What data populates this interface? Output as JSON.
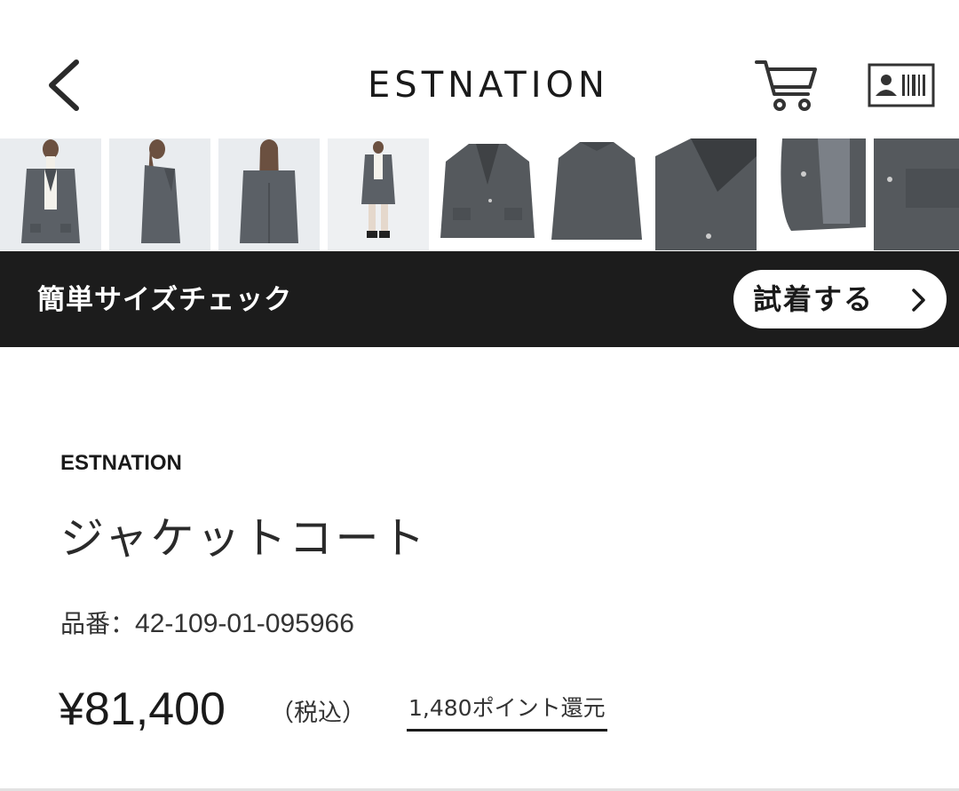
{
  "header": {
    "brand": "ESTNATION",
    "icons": {
      "back": "chevron-left-icon",
      "cart": "cart-icon",
      "member": "member-card-icon"
    }
  },
  "thumbnails": [
    {
      "name": "thumb-model-front"
    },
    {
      "name": "thumb-model-side"
    },
    {
      "name": "thumb-model-back"
    },
    {
      "name": "thumb-model-full"
    },
    {
      "name": "thumb-jacket-front"
    },
    {
      "name": "thumb-jacket-back"
    },
    {
      "name": "thumb-jacket-lapel"
    },
    {
      "name": "thumb-jacket-lining"
    },
    {
      "name": "thumb-jacket-pocket"
    }
  ],
  "size_banner": {
    "title": "簡単サイズチェック",
    "button_label": "試着する"
  },
  "product": {
    "brand": "ESTNATION",
    "name": "ジャケットコート",
    "code_label": "品番：",
    "code": "42-109-01-095966",
    "price": "¥81,400",
    "tax_note": "（税込）",
    "points": "1,480ポイント還元"
  },
  "colors": {
    "banner_bg": "#1c1c1c",
    "text": "#1a1a1a",
    "thumb_bg": "#eceef0",
    "jacket_gray": "#55595d"
  }
}
